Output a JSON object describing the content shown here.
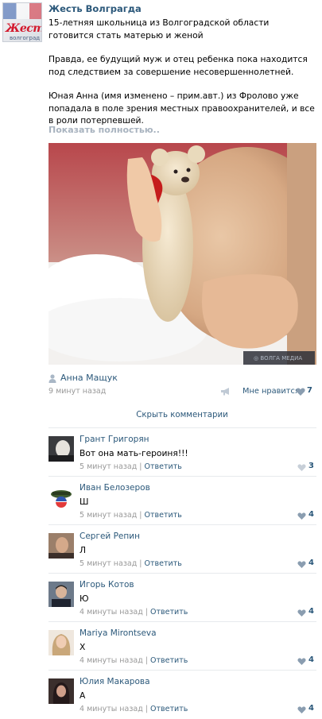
{
  "post": {
    "group_name": "Жесть Волграгда",
    "avatar_text": [
      "Жесть",
      "волгоград"
    ],
    "paragraphs": [
      "15-летняя школьница из Волгоградской области готовится стать матерью и женой",
      "Правда, ее будущий муж и отец ребенка пока находится под следствием за совершение несовершеннолетней.",
      "Юная Анна (имя изменено – прим.авт.) из Фролово уже попадала в поле зрения местных правоохранителей, и все в роли потерпевшей."
    ],
    "show_more": "Показать полностью..",
    "author": "Анна Мащук",
    "time": "9 минут назад",
    "like_label": "Мне нравится",
    "like_count": "7",
    "hide_comments": "Скрыть комментарии",
    "icons": {
      "author": "user-icon",
      "share": "share-megaphone-icon",
      "like": "heart-icon"
    }
  },
  "comments": [
    {
      "author": "Грант Григорян",
      "text": "Вот она мать-героиня!!!",
      "time": "5 минут назад",
      "reply": "Ответить",
      "likes": "3"
    },
    {
      "author": "Иван Белозеров",
      "text": "Ш",
      "time": "5 минут назад",
      "reply": "Ответить",
      "likes": "4"
    },
    {
      "author": "Сергей Репин",
      "text": "Л",
      "time": "5 минут назад",
      "reply": "Ответить",
      "likes": "4"
    },
    {
      "author": "Игорь Котов",
      "text": "Ю",
      "time": "4 минуты назад",
      "reply": "Ответить",
      "likes": "4"
    },
    {
      "author": "Mariya Mirontseva",
      "text": "Х",
      "time": "4 минуты назад",
      "reply": "Ответить",
      "likes": "4"
    },
    {
      "author": "Юлия Макарова",
      "text": "А",
      "time": "4 минуты назад",
      "reply": "Ответить",
      "likes": "4"
    }
  ],
  "colors": {
    "link": "#2b587a",
    "muted": "#999999",
    "heart_inactive": "#c7cfd8",
    "heart_active": "#8a9db0",
    "divider": "#e7eaed"
  }
}
